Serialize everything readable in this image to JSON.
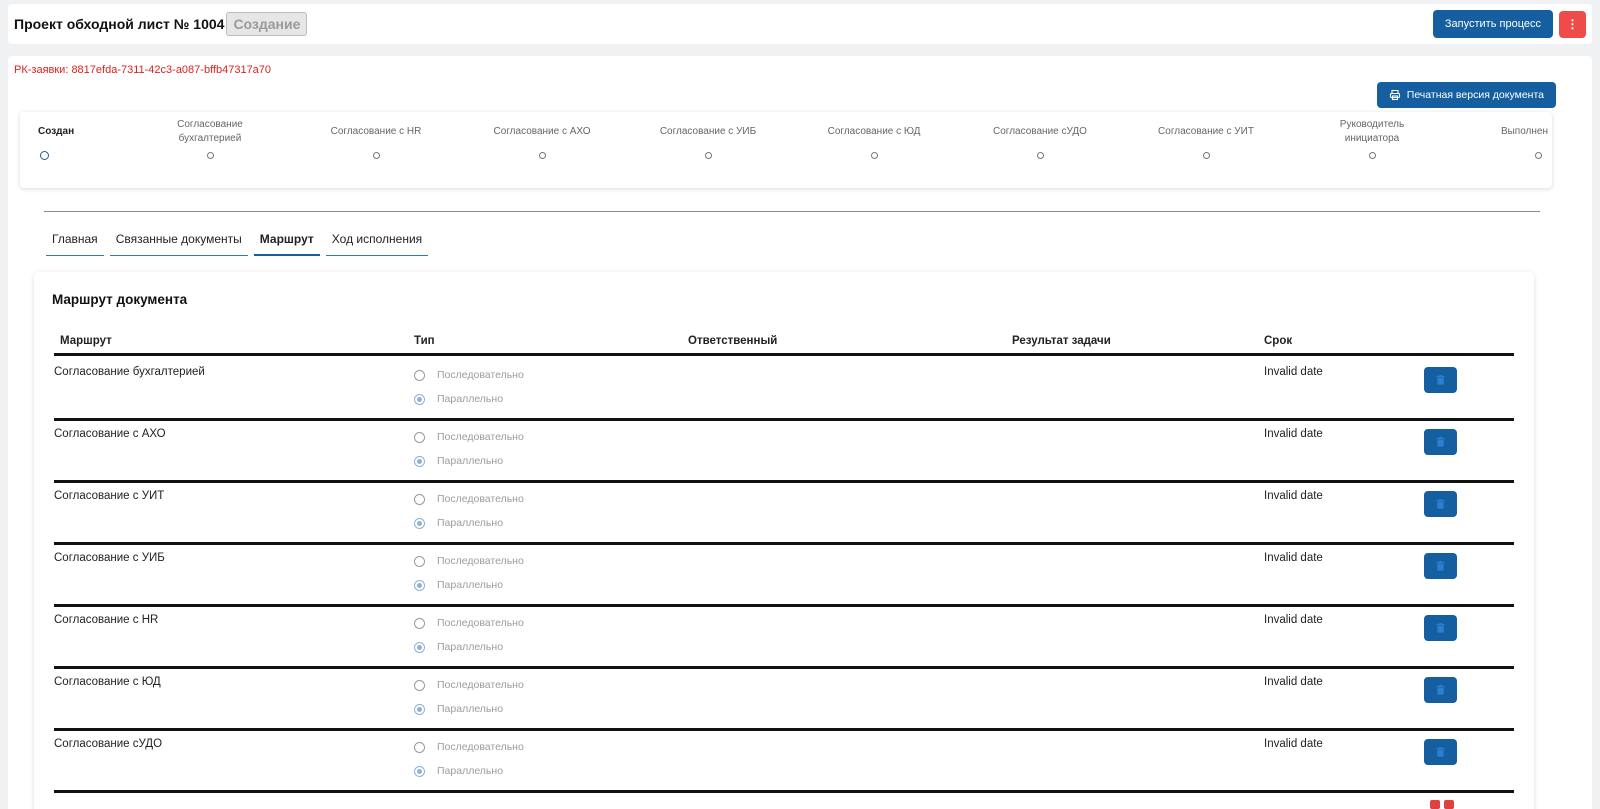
{
  "header": {
    "title": "Проект обходной лист № 1004",
    "status": "Создание",
    "start_button": "Запустить процесс",
    "menu_button": "⋮"
  },
  "rk_id": "РК-заявки: 8817efda-7311-42c3-a087-bffb47317a70",
  "print_button": "Печатная версия документа",
  "steps": [
    {
      "label": "Создан",
      "active": true
    },
    {
      "label": "Согласование бухгалтерией"
    },
    {
      "label": "Согласование с HR"
    },
    {
      "label": "Согласование с АХО"
    },
    {
      "label": "Согласование с УИБ"
    },
    {
      "label": "Согласование с ЮД"
    },
    {
      "label": "Согласование сУДО"
    },
    {
      "label": "Согласование с УИТ"
    },
    {
      "label": "Руководитель инициатора"
    },
    {
      "label": "Выполнен"
    }
  ],
  "tabs": [
    {
      "label": "Главная"
    },
    {
      "label": "Связанные документы"
    },
    {
      "label": "Маршрут",
      "active": true
    },
    {
      "label": "Ход исполнения"
    }
  ],
  "route": {
    "title": "Маршрут документа",
    "columns": {
      "route": "Маршрут",
      "type": "Тип",
      "responsible": "Ответственный",
      "result": "Результат задачи",
      "deadline": "Срок"
    },
    "option_sequential": "Последовательно",
    "option_parallel": "Параллельно",
    "rows": [
      {
        "name": "Согласование бухгалтерией",
        "date": "Invalid date"
      },
      {
        "name": "Согласование с АХО",
        "date": "Invalid date"
      },
      {
        "name": "Согласование с УИТ",
        "date": "Invalid date"
      },
      {
        "name": "Согласование с УИБ",
        "date": "Invalid date"
      },
      {
        "name": "Согласование с HR",
        "date": "Invalid date"
      },
      {
        "name": "Согласование с ЮД",
        "date": "Invalid date"
      },
      {
        "name": "Согласование сУДО",
        "date": "Invalid date"
      }
    ]
  },
  "colors": {
    "primary": "#155fa0",
    "danger": "#ef4b4b",
    "rk_text": "#e02020"
  }
}
